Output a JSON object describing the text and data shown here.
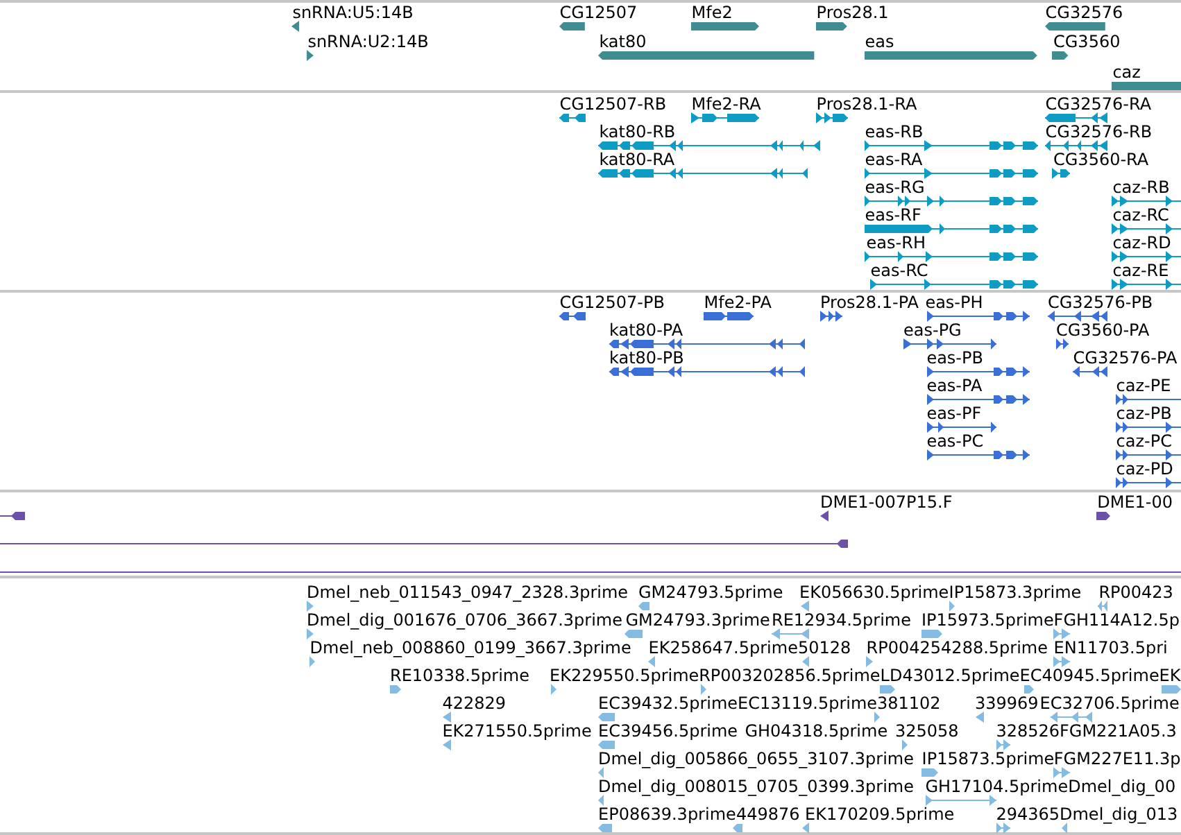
{
  "tracks": [
    {
      "color": "#408d91",
      "features": [
        {
          "label": "snRNA:U5:14B",
          "reverse": true
        },
        {
          "label": "CG12507",
          "reverse": true
        },
        {
          "label": "Mfe2",
          "reverse": false
        },
        {
          "label": "Pros28.1",
          "reverse": false
        },
        {
          "label": "CG32576",
          "reverse": true
        },
        {
          "label": "snRNA:U2:14B",
          "reverse": false
        },
        {
          "label": "kat80",
          "reverse": true
        },
        {
          "label": "eas",
          "reverse": false
        },
        {
          "label": "CG3560",
          "reverse": false
        },
        {
          "label": "caz"
        }
      ]
    },
    {
      "color": "#0e9cc4",
      "features": [
        {
          "label": "CG12507-RB",
          "reverse": true
        },
        {
          "label": "Mfe2-RA",
          "reverse": false
        },
        {
          "label": "Pros28.1-RA",
          "reverse": false
        },
        {
          "label": "CG32576-RA",
          "reverse": true
        },
        {
          "label": "kat80-RB",
          "reverse": true
        },
        {
          "label": "eas-RB",
          "reverse": false
        },
        {
          "label": "CG32576-RB",
          "reverse": true
        },
        {
          "label": "kat80-RA",
          "reverse": true
        },
        {
          "label": "eas-RA",
          "reverse": false
        },
        {
          "label": "CG3560-RA",
          "reverse": false
        },
        {
          "label": "eas-RG",
          "reverse": false
        },
        {
          "label": "caz-RB",
          "reverse": false
        },
        {
          "label": "eas-RF",
          "reverse": false
        },
        {
          "label": "caz-RC",
          "reverse": false
        },
        {
          "label": "eas-RH",
          "reverse": false
        },
        {
          "label": "caz-RD",
          "reverse": false
        },
        {
          "label": "eas-RC",
          "reverse": false
        },
        {
          "label": "caz-RE",
          "reverse": false
        }
      ]
    },
    {
      "color": "#3a6fd6",
      "features": [
        {
          "label": "CG12507-PB",
          "reverse": true
        },
        {
          "label": "Mfe2-PA",
          "reverse": false
        },
        {
          "label": "Pros28.1-PA",
          "reverse": false
        },
        {
          "label": "eas-PH",
          "reverse": false
        },
        {
          "label": "CG32576-PB",
          "reverse": true
        },
        {
          "label": "kat80-PA",
          "reverse": true
        },
        {
          "label": "eas-PG",
          "reverse": false
        },
        {
          "label": "CG3560-PA",
          "reverse": false
        },
        {
          "label": "kat80-PB",
          "reverse": true
        },
        {
          "label": "eas-PB",
          "reverse": false
        },
        {
          "label": "CG32576-PA",
          "reverse": true
        },
        {
          "label": "eas-PA",
          "reverse": false
        },
        {
          "label": "caz-PE",
          "reverse": false
        },
        {
          "label": "eas-PF",
          "reverse": false
        },
        {
          "label": "caz-PB",
          "reverse": false
        },
        {
          "label": "eas-PC",
          "reverse": false
        },
        {
          "label": "caz-PC",
          "reverse": false
        },
        {
          "label": "caz-PD",
          "reverse": false
        }
      ]
    },
    {
      "color": "#6b52a8",
      "features": [
        {
          "reverse": true
        },
        {
          "label": "DME1-007P15.F",
          "reverse": true
        },
        {
          "label": "DME1-00",
          "reverse": false
        },
        {
          "reverse": true
        }
      ]
    },
    {
      "color": "#84bbe2",
      "features": [
        {
          "label": "Dmel_neb_011543_0947_2328.3prime",
          "reverse": false
        },
        {
          "label": "GM24793.5prime",
          "reverse": true
        },
        {
          "label": "EK056630.5prime",
          "reverse": true
        },
        {
          "label": "IP15873.3prime",
          "reverse": false
        },
        {
          "label": "RP00423",
          "reverse": true
        },
        {
          "label": "Dmel_dig_001676_0706_3667.3prime",
          "reverse": false
        },
        {
          "label": "GM24793.3prime",
          "reverse": true
        },
        {
          "label": "RE12934.5prime",
          "reverse": true
        },
        {
          "label": "IP15973.5prime",
          "reverse": false
        },
        {
          "label": "FGH114A12.5p",
          "reverse": false
        },
        {
          "label": "Dmel_neb_008860_0199_3667.3prime",
          "reverse": false
        },
        {
          "label": "EK258647.5prime",
          "reverse": true
        },
        {
          "label": "50128",
          "reverse": true
        },
        {
          "label": "RP004254288.5prime",
          "reverse": false
        },
        {
          "label": "EN11703.5pri",
          "reverse": false
        },
        {
          "label": "RE10338.5prime",
          "reverse": false
        },
        {
          "label": "EK229550.5prime",
          "reverse": false
        },
        {
          "label": "RP003202856.5prime",
          "reverse": false
        },
        {
          "label": "LD43012.5prime",
          "reverse": false
        },
        {
          "label": "EC40945.5prime",
          "reverse": false
        },
        {
          "label": "EK",
          "reverse": false
        },
        {
          "label": "422829",
          "reverse": true
        },
        {
          "label": "EC39432.5prime",
          "reverse": true
        },
        {
          "label": "EC13119.5prime"
        },
        {
          "label": "381102",
          "reverse": false
        },
        {
          "label": "339969",
          "reverse": true
        },
        {
          "label": "EC32706.5prime",
          "reverse": true
        },
        {
          "label": "EK271550.5prime",
          "reverse": true
        },
        {
          "label": "EC39456.5prime",
          "reverse": true
        },
        {
          "label": "GH04318.5prime"
        },
        {
          "label": "325058",
          "reverse": false
        },
        {
          "label": "328526",
          "reverse": false
        },
        {
          "label": "FGM221A05.3"
        },
        {
          "label": "Dmel_dig_005866_0655_3107.3prime",
          "reverse": true
        },
        {
          "label": "IP15873.5prime",
          "reverse": false
        },
        {
          "label": "FGM227E11.3p",
          "reverse": false
        },
        {
          "label": "Dmel_dig_008015_0705_0399.3prime",
          "reverse": true
        },
        {
          "label": "GH17104.5prime",
          "reverse": false
        },
        {
          "label": "Dmel_dig_00"
        },
        {
          "label": "EP08639.3prime",
          "reverse": true
        },
        {
          "label": "449876",
          "reverse": true
        },
        {
          "label": "EK170209.5prime",
          "reverse": true
        },
        {
          "label": "294365",
          "reverse": false
        },
        {
          "label": "Dmel_dig_013",
          "reverse": true
        }
      ]
    }
  ]
}
